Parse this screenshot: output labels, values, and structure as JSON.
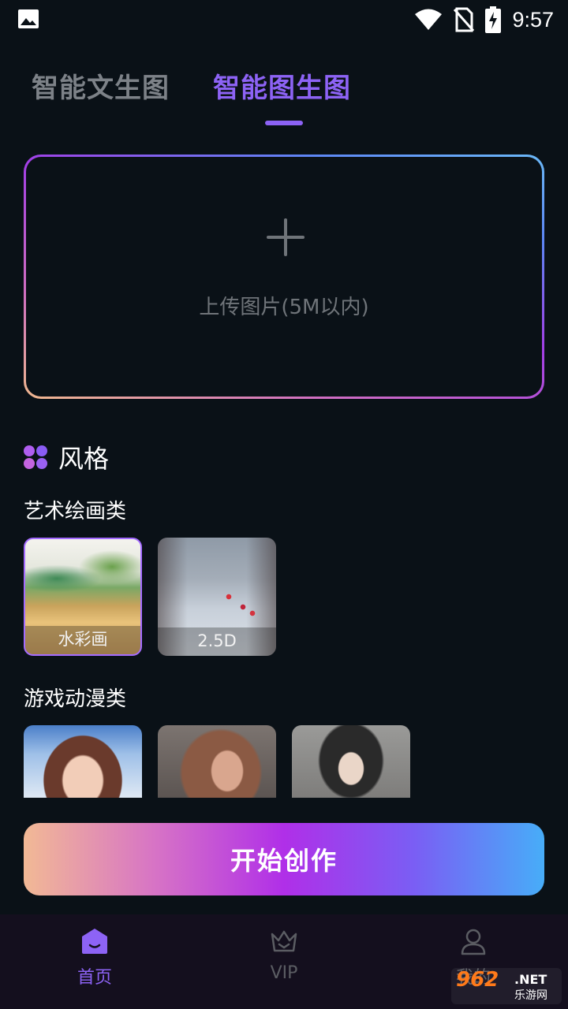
{
  "status_bar": {
    "time": "9:57",
    "icons": [
      "gallery-icon",
      "wifi-icon",
      "no-sim-icon",
      "battery-charging-icon"
    ]
  },
  "tabs": [
    {
      "label": "智能文生图",
      "active": false
    },
    {
      "label": "智能图生图",
      "active": true
    }
  ],
  "upload": {
    "icon": "plus-icon",
    "hint": "上传图片(5M以内)"
  },
  "style_section": {
    "title": "风格",
    "categories": [
      {
        "title": "艺术绘画类",
        "items": [
          {
            "label": "水彩画",
            "selected": true
          },
          {
            "label": "2.5D",
            "selected": false
          }
        ]
      },
      {
        "title": "游戏动漫类",
        "items": [
          {
            "label": "",
            "selected": false
          },
          {
            "label": "",
            "selected": false
          },
          {
            "label": "",
            "selected": false
          }
        ]
      }
    ]
  },
  "start_button": {
    "label": "开始创作"
  },
  "bottom_nav": [
    {
      "label": "首页",
      "icon": "home-icon",
      "active": true
    },
    {
      "label": "VIP",
      "icon": "crown-icon",
      "active": false
    },
    {
      "label": "我的",
      "icon": "user-icon",
      "active": false
    }
  ],
  "watermark": {
    "brand": "962",
    "net": ".NET",
    "sub": "乐游网"
  },
  "colors": {
    "background": "#0a1117",
    "accent": "#8d63f5",
    "inactive_text": "#7d8288",
    "nav_background": "#140f1e"
  }
}
